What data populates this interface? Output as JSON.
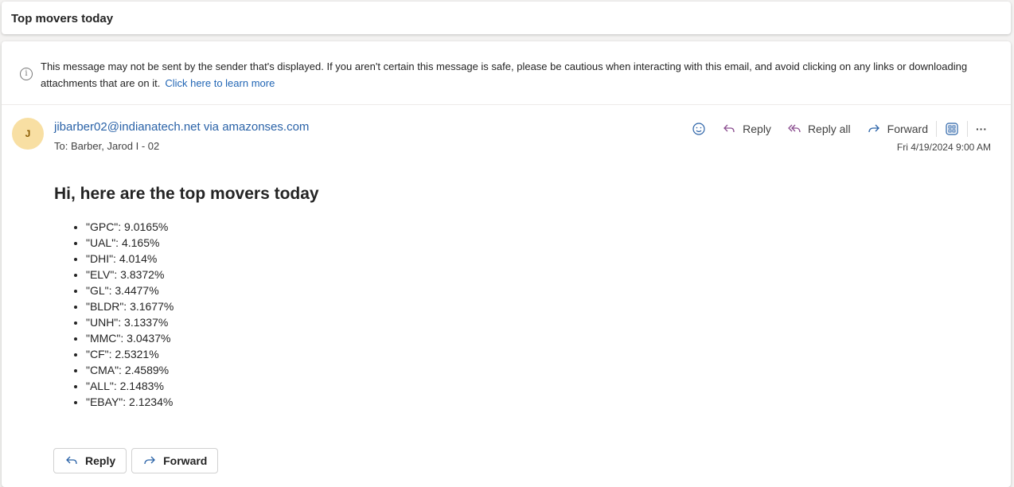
{
  "subject": "Top movers today",
  "warning": {
    "text": "This message may not be sent by the sender that's displayed. If you aren't certain this message is safe, please be cautious when interacting with this email, and avoid clicking on any links or downloading attachments that are on it.",
    "link": "Click here to learn more"
  },
  "sender": {
    "initial": "J",
    "from": "jibarber02@indianatech.net via amazonses.com",
    "to": "To:  Barber, Jarod I - 02",
    "date": "Fri 4/19/2024 9:00 AM"
  },
  "actions": {
    "reply": "Reply",
    "reply_all": "Reply all",
    "forward": "Forward",
    "more": "···"
  },
  "body": {
    "heading": "Hi, here are the top movers today",
    "items": [
      "\"GPC\": 9.0165%",
      "\"UAL\": 4.165%",
      "\"DHI\": 4.014%",
      "\"ELV\": 3.8372%",
      "\"GL\": 3.4477%",
      "\"BLDR\": 3.1677%",
      "\"UNH\": 3.1337%",
      "\"MMC\": 3.0437%",
      "\"CF\": 2.5321%",
      "\"CMA\": 2.4589%",
      "\"ALL\": 2.1483%",
      "\"EBAY\": 2.1234%"
    ]
  },
  "footer": {
    "reply": "Reply",
    "forward": "Forward"
  }
}
